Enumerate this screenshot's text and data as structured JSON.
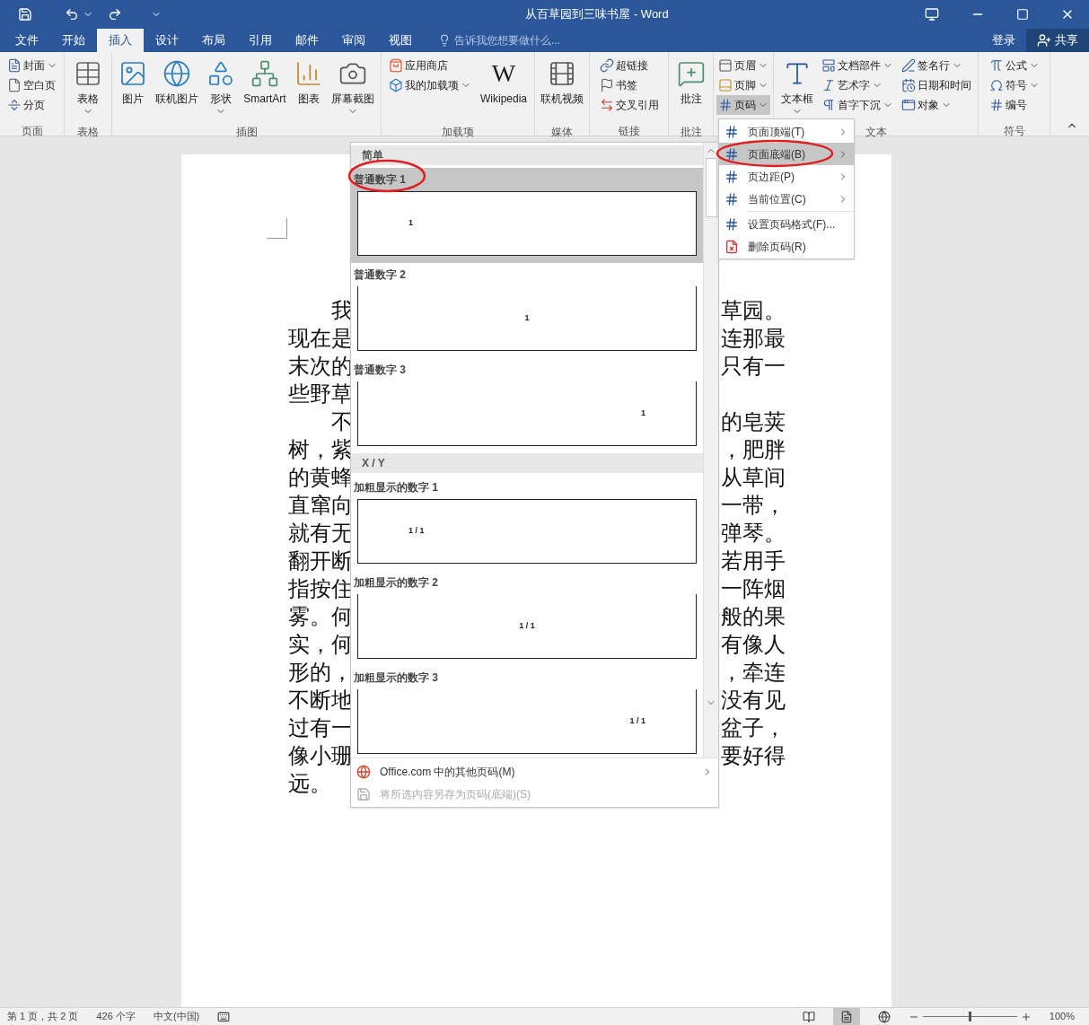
{
  "window": {
    "title": "从百草园到三味书屋 - Word"
  },
  "tabs": [
    {
      "label": "文件",
      "selected": false
    },
    {
      "label": "开始",
      "selected": false
    },
    {
      "label": "插入",
      "selected": true
    },
    {
      "label": "设计",
      "selected": false
    },
    {
      "label": "布局",
      "selected": false
    },
    {
      "label": "引用",
      "selected": false
    },
    {
      "label": "邮件",
      "selected": false
    },
    {
      "label": "审阅",
      "selected": false
    },
    {
      "label": "视图",
      "selected": false
    }
  ],
  "tell_me": {
    "placeholder": "告诉我您想要做什么..."
  },
  "account": {
    "sign_in": "登录",
    "share": "共享"
  },
  "ribbon": {
    "groups": [
      {
        "label": "页面",
        "columns": [
          [
            {
              "label": "封面",
              "kind": "small",
              "dropdown": true,
              "active": false
            },
            {
              "label": "空白页",
              "kind": "small",
              "dropdown": false,
              "active": false
            },
            {
              "label": "分页",
              "kind": "small",
              "dropdown": false,
              "active": false
            }
          ]
        ]
      },
      {
        "label": "表格",
        "columns": [
          [
            {
              "label": "表格",
              "kind": "large",
              "dropdown": true,
              "active": false
            }
          ]
        ]
      },
      {
        "label": "插图",
        "columns": [
          [
            {
              "label": "图片",
              "kind": "large",
              "dropdown": false,
              "active": false
            }
          ],
          [
            {
              "label": "联机图片",
              "kind": "large",
              "dropdown": false,
              "active": false
            }
          ],
          [
            {
              "label": "形状",
              "kind": "large",
              "dropdown": true,
              "active": false
            }
          ],
          [
            {
              "label": "SmartArt",
              "kind": "large",
              "dropdown": false,
              "active": false
            }
          ],
          [
            {
              "label": "图表",
              "kind": "large",
              "dropdown": false,
              "active": false
            }
          ],
          [
            {
              "label": "屏幕截图",
              "kind": "large",
              "dropdown": true,
              "active": false
            }
          ]
        ]
      },
      {
        "label": "加载项",
        "columns": [
          [
            {
              "label": "应用商店",
              "kind": "small",
              "dropdown": false,
              "active": false
            },
            {
              "label": "我的加载项",
              "kind": "small",
              "dropdown": true,
              "active": false
            }
          ],
          [
            {
              "label": "Wikipedia",
              "kind": "large",
              "dropdown": false,
              "active": false,
              "glyph": "W"
            }
          ]
        ]
      },
      {
        "label": "媒体",
        "columns": [
          [
            {
              "label": "联机视频",
              "kind": "large",
              "dropdown": false,
              "active": false
            }
          ]
        ]
      },
      {
        "label": "链接",
        "columns": [
          [
            {
              "label": "超链接",
              "kind": "small",
              "dropdown": false,
              "active": false
            },
            {
              "label": "书签",
              "kind": "small",
              "dropdown": false,
              "active": false
            },
            {
              "label": "交叉引用",
              "kind": "small",
              "dropdown": false,
              "active": false
            }
          ]
        ]
      },
      {
        "label": "批注",
        "columns": [
          [
            {
              "label": "批注",
              "kind": "large",
              "dropdown": false,
              "active": false
            }
          ]
        ]
      },
      {
        "columns": [
          [
            {
              "label": "页眉",
              "kind": "small",
              "dropdown": true,
              "active": false
            },
            {
              "label": "页脚",
              "kind": "small",
              "dropdown": true,
              "active": false
            },
            {
              "label": "页码",
              "kind": "small",
              "dropdown": true,
              "active": true
            }
          ]
        ]
      },
      {
        "label": "文本",
        "columns": [
          [
            {
              "label": "文本框",
              "kind": "large",
              "dropdown": true,
              "active": false
            }
          ],
          [
            {
              "label": "文档部件",
              "kind": "small",
              "dropdown": true,
              "active": false
            },
            {
              "label": "艺术字",
              "kind": "small",
              "dropdown": true,
              "active": false
            },
            {
              "label": "首字下沉",
              "kind": "small",
              "dropdown": true,
              "active": false
            }
          ],
          [
            {
              "label": "签名行",
              "kind": "small",
              "dropdown": true,
              "active": false
            },
            {
              "label": "日期和时间",
              "kind": "small",
              "dropdown": false,
              "active": false
            },
            {
              "label": "对象",
              "kind": "small",
              "dropdown": true,
              "active": false
            }
          ]
        ]
      },
      {
        "label": "符号",
        "columns": [
          [
            {
              "label": "公式",
              "kind": "small",
              "dropdown": true,
              "active": false
            },
            {
              "label": "符号",
              "kind": "small",
              "dropdown": true,
              "active": false
            },
            {
              "label": "编号",
              "kind": "small",
              "dropdown": false,
              "active": false
            }
          ]
        ]
      }
    ]
  },
  "document": {
    "lines": [
      {
        "left": "我",
        "right": "草园。",
        "indent": true
      },
      {
        "left": "现在是",
        "right": "连那最",
        "indent": false
      },
      {
        "left": "末次的",
        "right": "只有一",
        "indent": false
      },
      {
        "left": "些野草",
        "indent": false
      },
      {
        "left": "不",
        "right": "的皂荚",
        "indent": true
      },
      {
        "left": "树，紫",
        "right": "，肥胖",
        "indent": false
      },
      {
        "left": "的黄蜂",
        "right": "从草间",
        "indent": false
      },
      {
        "left": "直窜向",
        "right": "一带，",
        "indent": false
      },
      {
        "left": "就有无",
        "right": "弹琴。",
        "indent": false
      },
      {
        "left": "翻开断",
        "right": "若用手",
        "indent": false
      },
      {
        "left": "指按住",
        "right": "一阵烟",
        "indent": false
      },
      {
        "left": "雾。何",
        "right": "般的果",
        "indent": false
      },
      {
        "left": "实，何",
        "right": "有像人",
        "indent": false
      },
      {
        "left": "形的，",
        "right": "，牵连",
        "indent": false
      },
      {
        "left": "不断地",
        "right": "没有见",
        "indent": false
      },
      {
        "left": "过有一",
        "right": "盆子，",
        "indent": false
      },
      {
        "left": "像小珊",
        "right": "要好得",
        "indent": false
      },
      {
        "left": "远。",
        "indent": false
      }
    ]
  },
  "gallery": {
    "sections": [
      {
        "heading": "简单",
        "items": [
          {
            "label": "普通数字 1",
            "number": "1",
            "selected": true
          },
          {
            "label": "普通数字 2",
            "number": "1",
            "selected": false
          },
          {
            "label": "普通数字 3",
            "number": "1",
            "selected": false
          }
        ]
      },
      {
        "heading": "X / Y",
        "items": [
          {
            "label": "加粗显示的数字 1",
            "number": "1 / 1",
            "selected": false
          },
          {
            "label": "加粗显示的数字 2",
            "number": "1 / 1",
            "selected": false
          },
          {
            "label": "加粗显示的数字 3",
            "number": "1 / 1",
            "selected": false
          }
        ]
      }
    ],
    "footer": [
      {
        "label": "Office.com 中的其他页码(M)",
        "disabled": false,
        "submenu": true
      },
      {
        "label": "将所选内容另存为页码(底端)(S)",
        "disabled": true,
        "submenu": false
      }
    ]
  },
  "submenu": [
    {
      "label": "页面顶端(T)",
      "submenu": true,
      "selected": false
    },
    {
      "label": "页面底端(B)",
      "submenu": true,
      "selected": true
    },
    {
      "label": "页边距(P)",
      "submenu": true,
      "selected": false
    },
    {
      "label": "当前位置(C)",
      "submenu": true,
      "selected": false
    },
    {
      "label": "设置页码格式(F)...",
      "submenu": false,
      "selected": false
    },
    {
      "label": "删除页码(R)",
      "submenu": false,
      "selected": false
    }
  ],
  "status_bar": {
    "items": [
      "第 1 页，共 2 页",
      "426 个字",
      "中文(中国)"
    ],
    "zoom": {
      "label": "100%",
      "level": 0.5
    }
  }
}
